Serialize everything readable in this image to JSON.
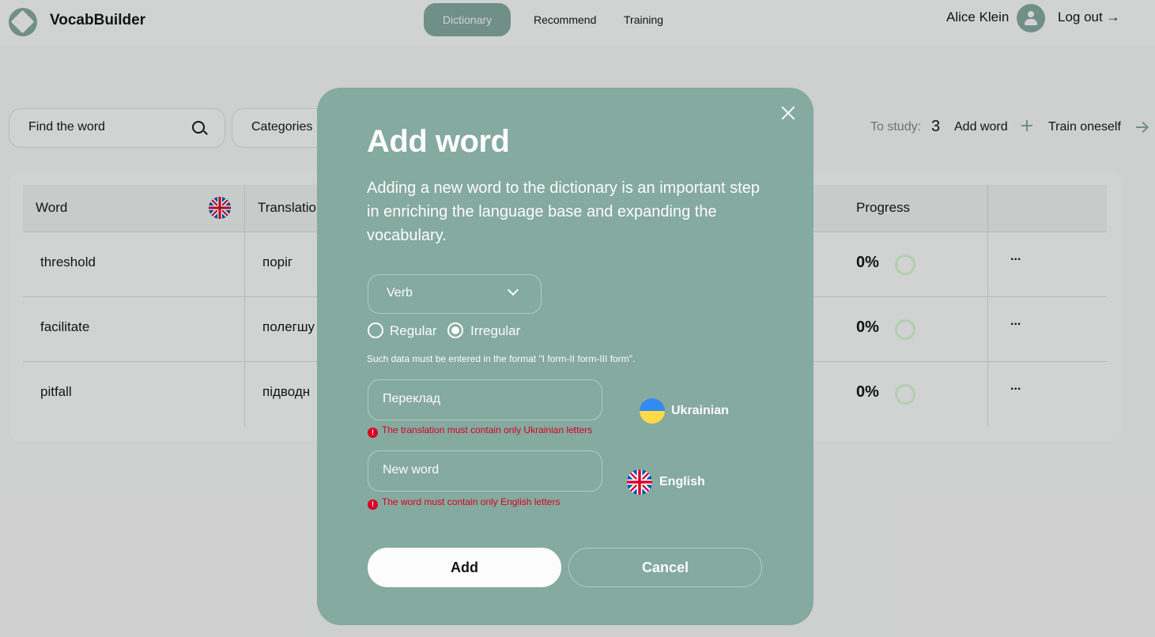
{
  "header": {
    "brand": "VocabBuilder",
    "nav": [
      "Dictionary",
      "Recommend",
      "Training"
    ],
    "user_name": "Alice Klein",
    "logout": "Log out →"
  },
  "toolbar": {
    "search_placeholder": "Find the word",
    "categories": "Categories",
    "to_study_label": "To study:",
    "to_study_count": "3",
    "add_word": "Add word",
    "train": "Train oneself"
  },
  "table": {
    "headers": [
      "Word",
      "Translation",
      "Progress"
    ],
    "rows": [
      {
        "word": "threshold",
        "translation": "поріг",
        "progress": "0%"
      },
      {
        "word": "facilitate",
        "translation": "полегшу",
        "progress": "0%"
      },
      {
        "word": "pitfall",
        "translation": "підводн",
        "progress": "0%"
      }
    ],
    "actions_glyph": "..."
  },
  "modal": {
    "title": "Add word",
    "description": "Adding a new word to the dictionary is an important step in enriching the language base and expanding the vocabulary.",
    "category_value": "Verb",
    "radio_regular": "Regular",
    "radio_irregular": "Irregular",
    "radio_selected": "Irregular",
    "hint": "Such data must be entered in the format \"I form-II form-III form\".",
    "translation_placeholder": "Переклад",
    "translation_error": "The translation must contain only Ukrainian letters",
    "translation_lang": "Ukrainian",
    "word_placeholder": "New word",
    "word_error": "The word must contain only English letters",
    "word_lang": "English",
    "add_button": "Add",
    "cancel_button": "Cancel",
    "error_glyph": "!"
  },
  "colors": {
    "accent": "#85aa9f",
    "background": "#f8f8f8",
    "error": "#d80027",
    "text": "#121417"
  },
  "icons": [
    "logo-icon",
    "search-icon",
    "plus-icon",
    "arrow-right-icon",
    "user-icon",
    "uk-flag-icon",
    "ua-flag-icon",
    "close-icon",
    "chevron-down-icon",
    "error-icon",
    "progress-ring-icon"
  ]
}
